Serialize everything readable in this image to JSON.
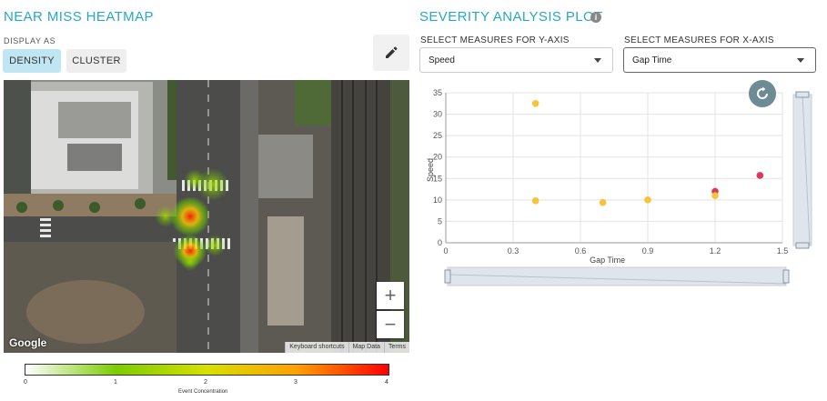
{
  "heatmap": {
    "title": "NEAR MISS HEATMAP",
    "display_as_label": "DISPLAY AS",
    "density_label": "DENSITY",
    "cluster_label": "CLUSTER",
    "edit_icon": "pencil-icon",
    "map": {
      "google_label": "Google",
      "footer": [
        "Keyboard shortcuts",
        "Map Data",
        "Terms"
      ],
      "zoom_in": "+",
      "zoom_out": "−"
    },
    "legend": {
      "ticks": [
        "0",
        "1",
        "2",
        "3",
        "4"
      ],
      "label": "Event Concentration",
      "colors": [
        "#ffffff",
        "#7ccc00",
        "#d7e000",
        "#ff9f00",
        "#ff0000"
      ]
    }
  },
  "severity": {
    "title": "SEVERITY ANALYSIS PLOT",
    "info_icon": "info-icon",
    "y_select_label": "SELECT MEASURES FOR Y-AXIS",
    "x_select_label": "SELECT MEASURES FOR X-AXIS",
    "y_selected": "Speed",
    "x_selected": "Gap Time",
    "reset_icon": "refresh-icon"
  },
  "chart_data": {
    "type": "scatter",
    "xlabel": "Gap Time",
    "ylabel": "Speed",
    "xlim": [
      0,
      1.5
    ],
    "ylim": [
      0,
      35
    ],
    "xticks": [
      "0",
      "0.3",
      "0.6",
      "0.9",
      "1.2",
      "1.5"
    ],
    "yticks": [
      "0",
      "5",
      "10",
      "15",
      "20",
      "25",
      "30",
      "35"
    ],
    "grid": true,
    "points": [
      {
        "x": 0.4,
        "y": 32.5,
        "color": "#f7c338"
      },
      {
        "x": 0.4,
        "y": 9.8,
        "color": "#f7c338"
      },
      {
        "x": 0.7,
        "y": 9.4,
        "color": "#f7c338"
      },
      {
        "x": 0.9,
        "y": 10.0,
        "color": "#f7c338"
      },
      {
        "x": 1.2,
        "y": 12.0,
        "color": "#e0385a"
      },
      {
        "x": 1.2,
        "y": 11.0,
        "color": "#f7c338"
      },
      {
        "x": 1.4,
        "y": 15.7,
        "color": "#e0385a"
      }
    ]
  }
}
